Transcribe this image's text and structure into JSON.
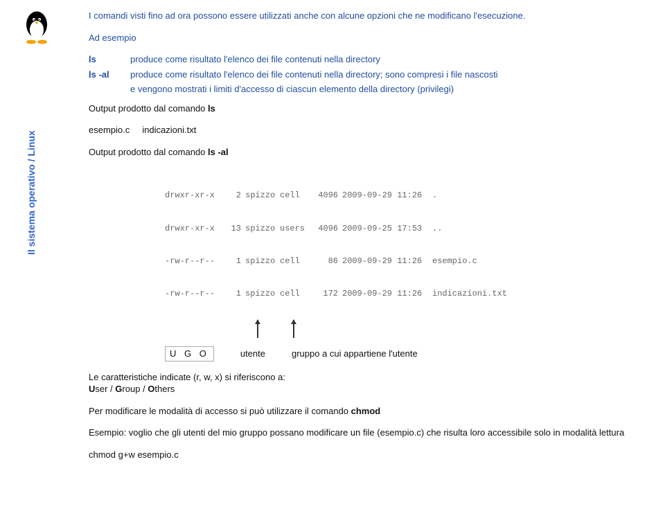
{
  "sidebar": {
    "title": "Il sistema operativo / Linux"
  },
  "intro": {
    "p1": "I comandi visti fino ad ora possono essere utilizzati anche con alcune opzioni che ne modificano l'esecuzione.",
    "p2": "Ad esempio"
  },
  "defs": {
    "ls_cmd": "ls",
    "ls_desc": "produce come risultato l'elenco dei file contenuti nella directory",
    "lsal_cmd": "ls  -al",
    "lsal_desc": "produce come risultato l'elenco dei file contenuti nella directory; sono compresi i file nascosti",
    "lsal_cont": "e vengono mostrati i limiti d'accesso di ciascun elemento della directory (privilegi)"
  },
  "out1": {
    "heading": "Output prodotto dal comando ",
    "cmd": "ls",
    "file1": "esempio.c",
    "file2": "indicazioni.txt"
  },
  "out2": {
    "heading": "Output prodotto dal comando ",
    "cmd": "ls -al",
    "rows": [
      {
        "perm": "drwxr-xr-x",
        "cnt": "2",
        "own": "spizzo",
        "grp": "cell",
        "sz": "4096",
        "date": "2009-09-29 11:26",
        "name": "."
      },
      {
        "perm": "drwxr-xr-x",
        "cnt": "13",
        "own": "spizzo",
        "grp": "users",
        "sz": "4096",
        "date": "2009-09-25 17:53",
        "name": ".."
      },
      {
        "perm": "-rw-r--r--",
        "cnt": "1",
        "own": "spizzo",
        "grp": "cell",
        "sz": "86",
        "date": "2009-09-29 11:26",
        "name": "esempio.c"
      },
      {
        "perm": "-rw-r--r--",
        "cnt": "1",
        "own": "spizzo",
        "grp": "cell",
        "sz": "172",
        "date": "2009-09-29 11:26",
        "name": "indicazioni.txt"
      }
    ]
  },
  "labels": {
    "ugo": "U  G  O",
    "utente": "utente",
    "gruppo": "gruppo a cui appartiene l'utente"
  },
  "bottom": {
    "caratt": "Le caratteristiche indicate (r, w, x) si riferiscono a:",
    "ugo_long_u": "U",
    "ugo_long_user": "ser  /  ",
    "ugo_long_g": "G",
    "ugo_long_group": "roup  /  ",
    "ugo_long_o": "O",
    "ugo_long_others": "thers",
    "chmod_line": "Per modificare le modalità di accesso si può utilizzare il comando ",
    "chmod_cmd": "chmod",
    "esempio": "Esempio: voglio che gli utenti del mio gruppo possano modificare un file (esempio.c) che risulta loro accessibile solo in modalità lettura",
    "chmod_ex": "chmod g+w esempio.c"
  }
}
